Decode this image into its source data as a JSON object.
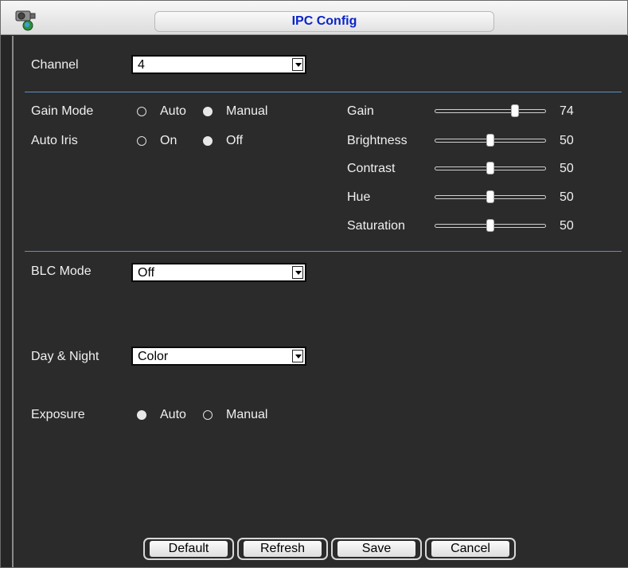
{
  "window": {
    "title": "IPC Config"
  },
  "fields": {
    "channel": {
      "label": "Channel",
      "value": "4"
    },
    "gain_mode": {
      "label": "Gain Mode",
      "options": [
        "Auto",
        "Manual"
      ],
      "selected": "Manual"
    },
    "auto_iris": {
      "label": "Auto Iris",
      "options": [
        "On",
        "Off"
      ],
      "selected": "Off"
    },
    "blc_mode": {
      "label": "BLC Mode",
      "value": "Off"
    },
    "day_night": {
      "label": "Day & Night",
      "value": "Color"
    },
    "exposure": {
      "label": "Exposure",
      "options": [
        "Auto",
        "Manual"
      ],
      "selected": "Auto"
    }
  },
  "sliders": [
    {
      "label": "Gain",
      "value": "74"
    },
    {
      "label": "Brightness",
      "value": "50"
    },
    {
      "label": "Contrast",
      "value": "50"
    },
    {
      "label": "Hue",
      "value": "50"
    },
    {
      "label": "Saturation",
      "value": "50"
    }
  ],
  "buttons": {
    "default": "Default",
    "refresh": "Refresh",
    "save": "Save",
    "cancel": "Cancel"
  },
  "colors": {
    "title": "#0a24c9",
    "separator": "#5f8fc7",
    "background": "#2b2b2b"
  },
  "icons": {
    "app": "camera-icon",
    "dropdown": "chevron-down-icon"
  }
}
